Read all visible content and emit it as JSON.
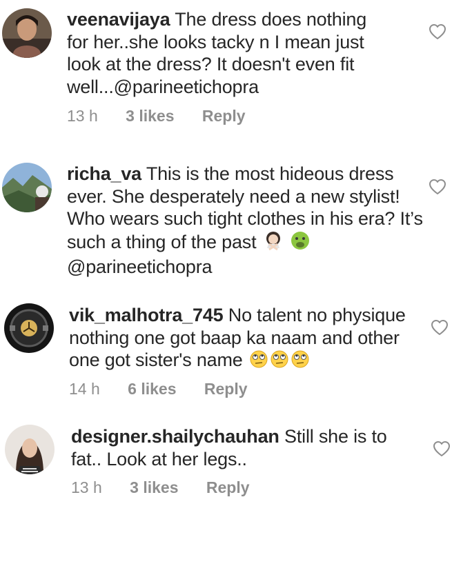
{
  "comments": [
    {
      "username": "veenavijaya",
      "text": "The dress does nothing for her..she looks tacky n I mean just look at the dress? It doesn't even fit well...",
      "mention": "@parineetichopra",
      "time": "13 h",
      "likes": "3 likes",
      "reply": "Reply",
      "avatar_icon": "profile-photo",
      "heart_icon": "heart-outline-icon"
    },
    {
      "username": "richa_va",
      "text": "This is the most hideous dress ever. She desperately need a new stylist! Who wears such tight clothes in his era? It’s such a thing of the past",
      "emojis": [
        "woman-gesturing-no-emoji",
        "nauseated-face-emoji"
      ],
      "mention": "@parineetichopra",
      "avatar_icon": "profile-photo",
      "heart_icon": "heart-outline-icon"
    },
    {
      "username": "vik_malhotra_745",
      "text": "No talent no physique nothing one got baap ka naam and other one got sister's name",
      "emojis": [
        "eye-roll-emoji",
        "eye-roll-emoji",
        "eye-roll-emoji"
      ],
      "time": "14 h",
      "likes": "6 likes",
      "reply": "Reply",
      "avatar_icon": "steering-wheel-photo",
      "heart_icon": "heart-outline-icon"
    },
    {
      "username": "designer.shailychauhan",
      "text": "Still she is to fat.. Look at her legs..",
      "time": "13 h",
      "likes": "3 likes",
      "reply": "Reply",
      "avatar_icon": "profile-photo",
      "heart_icon": "heart-outline-icon"
    }
  ]
}
